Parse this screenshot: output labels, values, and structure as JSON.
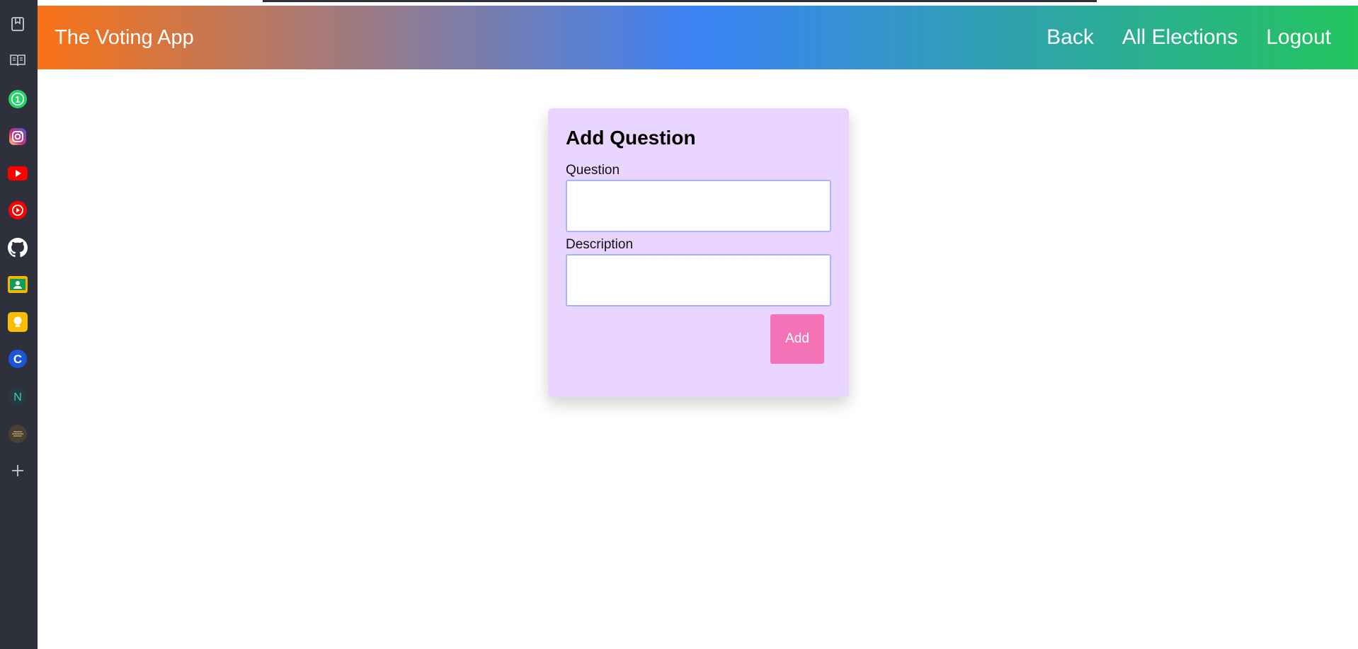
{
  "sidebar": {
    "icons": [
      "bookmark-icon",
      "reading-list-icon",
      "whatsapp-icon",
      "instagram-icon",
      "youtube-icon",
      "youtube-music-icon",
      "github-icon",
      "contacts-icon",
      "keep-icon",
      "c-app-icon",
      "n-app-icon",
      "profile-app-icon",
      "add-icon"
    ],
    "badges": {
      "whatsapp": "1",
      "c_app": "C",
      "n_app": "N"
    }
  },
  "navbar": {
    "brand": "The Voting App",
    "links": [
      "Back",
      "All Elections",
      "Logout"
    ],
    "gradient": [
      "#f97316",
      "#3b82f6",
      "#22c55e"
    ]
  },
  "form": {
    "title": "Add Question",
    "question_label": "Question",
    "question_value": "",
    "description_label": "Description",
    "description_value": "",
    "submit_label": "Add",
    "card_color": "#e9d5ff",
    "button_color": "#f472b6"
  }
}
